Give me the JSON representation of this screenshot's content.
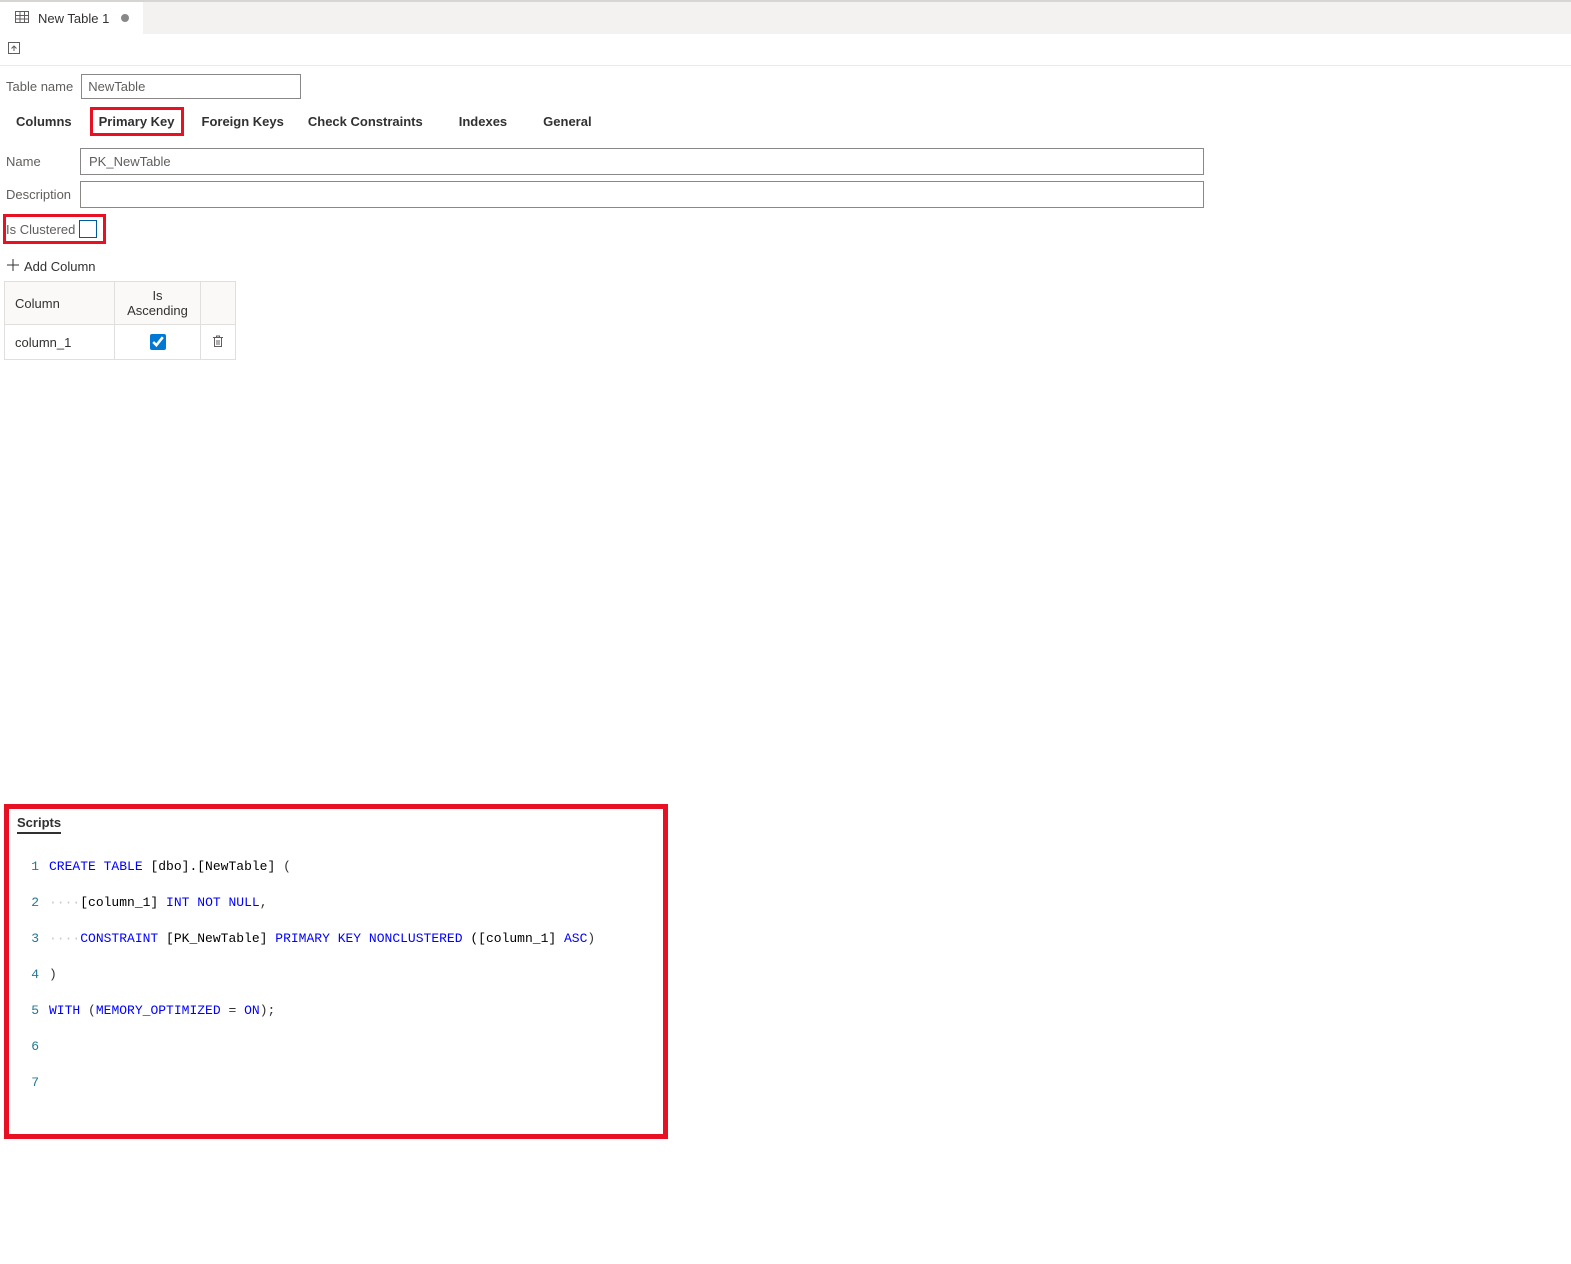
{
  "topTab": {
    "label": "New Table 1"
  },
  "tableNameLabel": "Table name",
  "tableNameValue": "NewTable",
  "innerTabs": {
    "columns": "Columns",
    "primaryKey": "Primary Key",
    "foreignKeys": "Foreign Keys",
    "checkConstraints": "Check Constraints",
    "indexes": "Indexes",
    "general": "General"
  },
  "form": {
    "nameLabel": "Name",
    "nameValue": "PK_NewTable",
    "descLabel": "Description",
    "descValue": "",
    "isClusteredLabel": "Is Clustered"
  },
  "addColumnLabel": "Add Column",
  "pkGrid": {
    "headers": {
      "column": "Column",
      "isAsc": "Is Ascending"
    },
    "rows": [
      {
        "column": "column_1",
        "isAsc": true
      }
    ]
  },
  "scripts": {
    "title": "Scripts",
    "sql": {
      "l1": {
        "kw1": "CREATE",
        "kw2": "TABLE",
        "id": "[dbo].[NewTable]",
        "tail": " ("
      },
      "l2": {
        "id": "[column_1]",
        "kw1": "INT",
        "kw2": "NOT",
        "kw3": "NULL",
        "tail": ","
      },
      "l3": {
        "kw1": "CONSTRAINT",
        "id1": "[PK_NewTable]",
        "kw2": "PRIMARY",
        "kw3": "KEY",
        "kw4": "NONCLUSTERED",
        "id2": "([column_1]",
        "kw5": "ASC",
        "tail": ")"
      },
      "l4": {
        "text": ")"
      },
      "l5": {
        "kw1": "WITH",
        "p1": "(",
        "kw2": "MEMORY_OPTIMIZED",
        "eq": " = ",
        "kw3": "ON",
        "tail": ");"
      }
    },
    "lineNumbers": [
      "1",
      "2",
      "3",
      "4",
      "5",
      "6",
      "7"
    ]
  }
}
